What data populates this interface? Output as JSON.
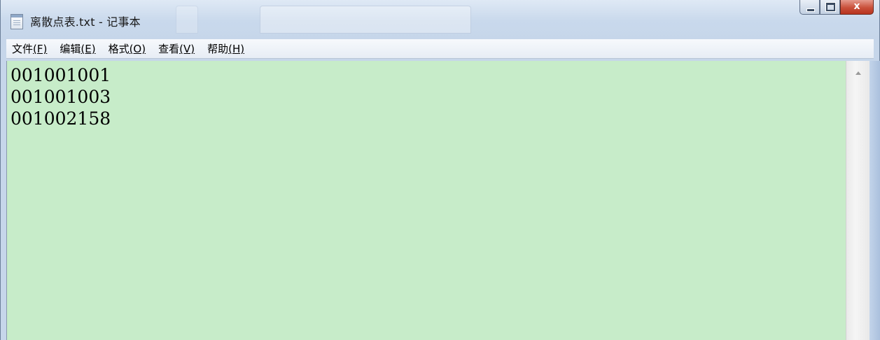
{
  "window": {
    "title": "离散点表.txt - 记事本",
    "close_label": "x"
  },
  "menu": {
    "items": [
      {
        "label": "文件",
        "accel": "(F)"
      },
      {
        "label": "编辑",
        "accel": "(E)"
      },
      {
        "label": "格式",
        "accel": "(O)"
      },
      {
        "label": "查看",
        "accel": "(V)"
      },
      {
        "label": "帮助",
        "accel": "(H)"
      }
    ]
  },
  "editor": {
    "lines": [
      "001001001",
      "001001003",
      "001002158"
    ],
    "background": "#c7ecc9"
  },
  "icons": {
    "app": "notepad-document-icon",
    "minimize": "minimize-icon",
    "maximize": "maximize-icon",
    "close": "close-icon",
    "scroll_up": "scroll-up-arrow-icon"
  }
}
